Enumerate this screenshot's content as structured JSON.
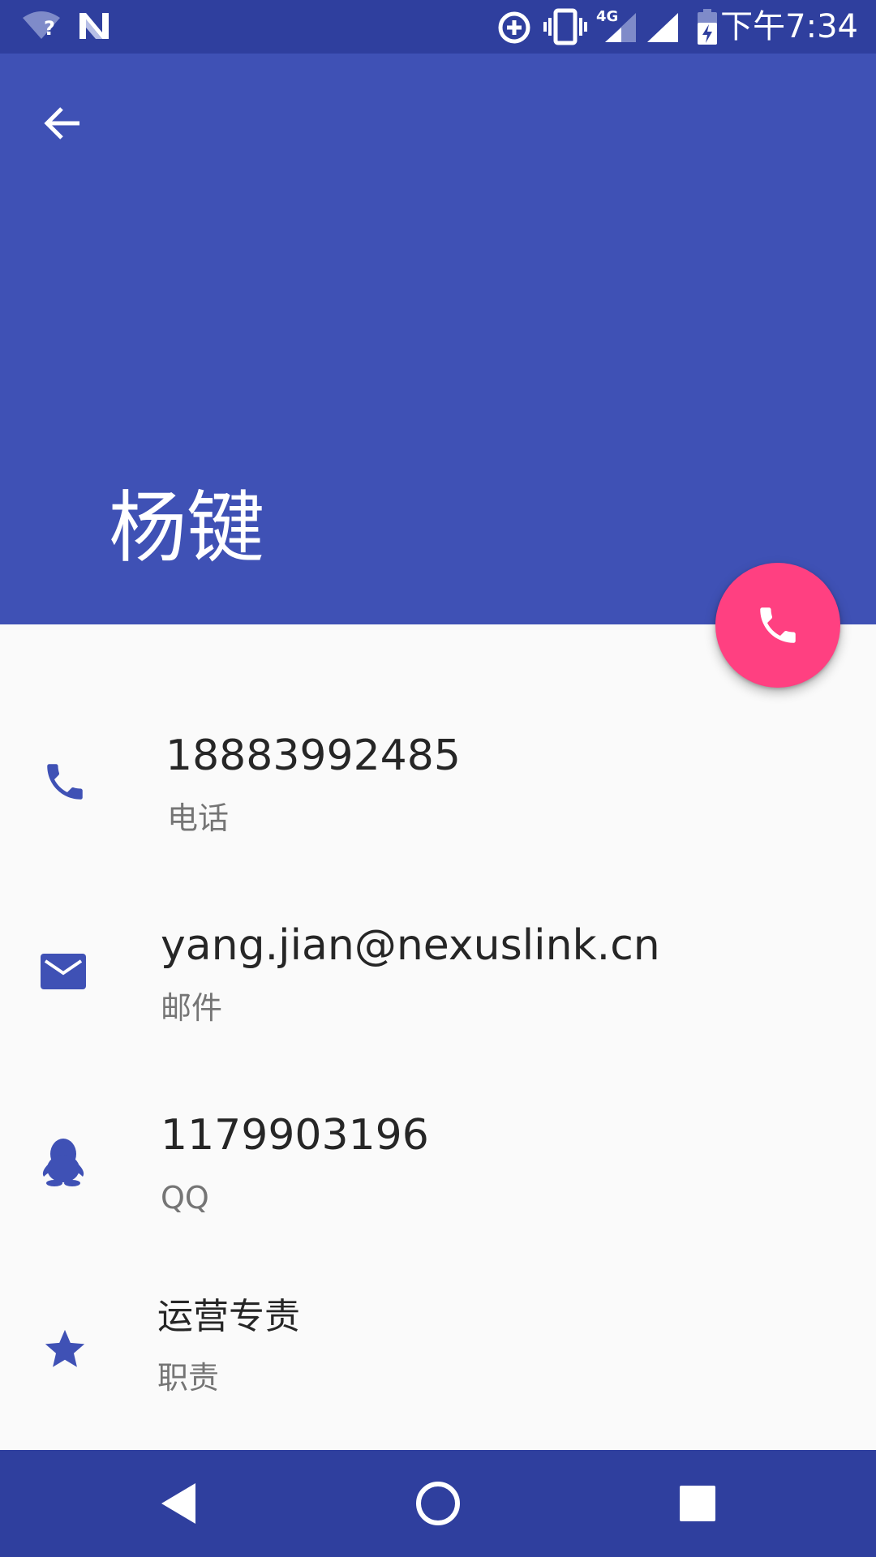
{
  "status_bar": {
    "time": "下午7:34",
    "network_label": "4G",
    "wifi_question": "?",
    "icons": [
      "wifi-unknown-icon",
      "n-notification-icon",
      "data-saver-icon",
      "vibrate-icon",
      "signal-4g-icon",
      "signal-icon",
      "battery-charging-icon"
    ],
    "background": "#2f3f9e"
  },
  "header": {
    "name": "杨键",
    "background": "#3f51b5",
    "back_icon": "arrow-back-icon"
  },
  "fab": {
    "icon": "phone-icon",
    "color": "#ff4081"
  },
  "details": [
    {
      "icon": "phone-icon",
      "value": "18883992485",
      "label": "电话"
    },
    {
      "icon": "mail-icon",
      "value": "yang.jian@nexuslink.cn",
      "label": "邮件"
    },
    {
      "icon": "qq-penguin-icon",
      "value": "1179903196",
      "label": "QQ"
    },
    {
      "icon": "star-icon",
      "value": "运营专责",
      "label": "职责"
    }
  ],
  "accent_icon_color": "#3f51b5",
  "nav_bar": {
    "buttons": [
      "nav-back-icon",
      "nav-home-icon",
      "nav-recents-icon"
    ],
    "background": "#2f3f9e"
  }
}
